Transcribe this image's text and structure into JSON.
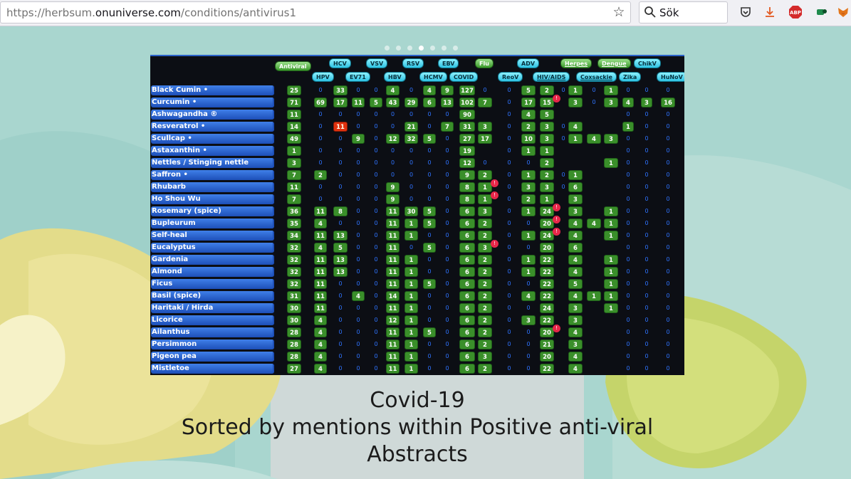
{
  "browser": {
    "url_prefix": "https://herbsum.",
    "url_host": "onuniverse.com",
    "url_path": "/conditions/antivirus1",
    "search_placeholder": "Sök"
  },
  "carousel": {
    "dot_count": 7,
    "active_index": 3
  },
  "table": {
    "headers_top": [
      "Antiviral",
      "HCV",
      "VSV",
      "RSV",
      "EBV",
      "Flu",
      "ADV",
      "Herpes",
      "Dengue",
      "ChikV"
    ],
    "headers_bottom": [
      "HPV",
      "EV71",
      "HBV",
      "HCMV",
      "COVID",
      "ReoV",
      "HIV/AIDS",
      "Coxsackie",
      "Zika",
      "HuNoV"
    ],
    "rows": [
      {
        "name": "Black Cumin •",
        "cells": [
          "25",
          "0",
          "33",
          "0",
          "0",
          "4",
          "0",
          "4",
          "9",
          "127",
          "0",
          "0",
          "5",
          "2",
          "0",
          "1",
          "0",
          "1",
          "0",
          "0",
          "0"
        ]
      },
      {
        "name": "Curcumin •",
        "cells": [
          "71",
          "69",
          "17",
          "11",
          "5",
          "43",
          "29",
          "6",
          "13",
          "102",
          "7",
          "0",
          "17",
          "15",
          "",
          "3",
          "0",
          "3",
          "4",
          "3",
          "16"
        ]
      },
      {
        "name": "Ashwagandha ®",
        "cells": [
          "11",
          "0",
          "0",
          "0",
          "0",
          "0",
          "0",
          "0",
          "0",
          "90",
          "",
          "0",
          "4",
          "5",
          "",
          "",
          "",
          "",
          "0",
          "0",
          "0"
        ]
      },
      {
        "name": "Resveratrol •",
        "cells": [
          "14",
          "0",
          "11",
          "0",
          "0",
          "0",
          "21",
          "0",
          "7",
          "31",
          "3",
          "0",
          "2",
          "3",
          "0",
          "4",
          "",
          "",
          "1",
          "0",
          "0"
        ]
      },
      {
        "name": "Scullcap •",
        "cells": [
          "49",
          "0",
          "0",
          "9",
          "0",
          "12",
          "32",
          "5",
          "0",
          "27",
          "17",
          "0",
          "10",
          "3",
          "0",
          "1",
          "4",
          "3",
          "0",
          "0",
          "0"
        ]
      },
      {
        "name": "Astaxanthin •",
        "cells": [
          "1",
          "0",
          "0",
          "0",
          "0",
          "0",
          "0",
          "0",
          "0",
          "19",
          "",
          "0",
          "1",
          "1",
          "",
          "",
          "",
          "",
          "0",
          "0",
          "0"
        ]
      },
      {
        "name": "Nettles / Stinging nettle",
        "cells": [
          "3",
          "0",
          "0",
          "0",
          "0",
          "0",
          "0",
          "0",
          "0",
          "12",
          "0",
          "0",
          "0",
          "2",
          "",
          "",
          "",
          "1",
          "0",
          "0",
          "0"
        ]
      },
      {
        "name": "Saffron •",
        "cells": [
          "7",
          "2",
          "0",
          "0",
          "0",
          "0",
          "0",
          "0",
          "0",
          "9",
          "2",
          "0",
          "1",
          "2",
          "0",
          "1",
          "",
          "",
          "0",
          "0",
          "0"
        ]
      },
      {
        "name": "Rhubarb",
        "cells": [
          "11",
          "0",
          "0",
          "0",
          "0",
          "9",
          "0",
          "0",
          "0",
          "8",
          "1",
          "0",
          "3",
          "3",
          "0",
          "6",
          "",
          "",
          "0",
          "0",
          "0"
        ]
      },
      {
        "name": "Ho Shou Wu",
        "cells": [
          "7",
          "0",
          "0",
          "0",
          "0",
          "9",
          "0",
          "0",
          "0",
          "8",
          "1",
          "0",
          "2",
          "1",
          "",
          "3",
          "",
          "",
          "0",
          "0",
          "0"
        ]
      },
      {
        "name": "Rosemary (spice)",
        "cells": [
          "36",
          "11",
          "8",
          "0",
          "0",
          "11",
          "30",
          "5",
          "0",
          "6",
          "3",
          "0",
          "1",
          "24",
          "",
          "3",
          "",
          "1",
          "0",
          "0",
          "0"
        ]
      },
      {
        "name": "Bupleurum",
        "cells": [
          "35",
          "4",
          "0",
          "0",
          "0",
          "11",
          "1",
          "5",
          "0",
          "6",
          "2",
          "0",
          "0",
          "20",
          "",
          "4",
          "4",
          "1",
          "0",
          "0",
          "0"
        ]
      },
      {
        "name": "Self-heal",
        "cells": [
          "34",
          "11",
          "13",
          "0",
          "0",
          "11",
          "1",
          "0",
          "0",
          "6",
          "2",
          "0",
          "1",
          "24",
          "",
          "4",
          "",
          "1",
          "0",
          "0",
          "0"
        ]
      },
      {
        "name": "Eucalyptus",
        "cells": [
          "32",
          "4",
          "5",
          "0",
          "0",
          "11",
          "0",
          "5",
          "0",
          "6",
          "3",
          "0",
          "0",
          "20",
          "",
          "6",
          "",
          "",
          "0",
          "0",
          "0"
        ]
      },
      {
        "name": "Gardenia",
        "cells": [
          "32",
          "11",
          "13",
          "0",
          "0",
          "11",
          "1",
          "0",
          "0",
          "6",
          "2",
          "0",
          "1",
          "22",
          "",
          "4",
          "",
          "1",
          "0",
          "0",
          "0"
        ]
      },
      {
        "name": "Almond",
        "cells": [
          "32",
          "11",
          "13",
          "0",
          "0",
          "11",
          "1",
          "0",
          "0",
          "6",
          "2",
          "0",
          "1",
          "22",
          "",
          "4",
          "",
          "1",
          "0",
          "0",
          "0"
        ]
      },
      {
        "name": "Ficus",
        "cells": [
          "32",
          "11",
          "0",
          "0",
          "0",
          "11",
          "1",
          "5",
          "0",
          "6",
          "2",
          "0",
          "0",
          "22",
          "",
          "5",
          "",
          "1",
          "0",
          "0",
          "0"
        ]
      },
      {
        "name": "Basil (spice)",
        "cells": [
          "31",
          "11",
          "0",
          "4",
          "0",
          "14",
          "1",
          "0",
          "0",
          "6",
          "2",
          "0",
          "4",
          "22",
          "",
          "4",
          "1",
          "1",
          "0",
          "0",
          "0"
        ]
      },
      {
        "name": "Haritaki / Hirda",
        "cells": [
          "30",
          "11",
          "0",
          "0",
          "0",
          "11",
          "1",
          "0",
          "0",
          "6",
          "2",
          "0",
          "0",
          "24",
          "",
          "3",
          "",
          "1",
          "0",
          "0",
          "0"
        ]
      },
      {
        "name": "Licorice",
        "cells": [
          "30",
          "4",
          "0",
          "0",
          "0",
          "12",
          "1",
          "0",
          "0",
          "6",
          "2",
          "0",
          "3",
          "22",
          "",
          "3",
          "",
          "",
          "0",
          "0",
          "0"
        ]
      },
      {
        "name": "Ailanthus",
        "cells": [
          "28",
          "4",
          "0",
          "0",
          "0",
          "11",
          "1",
          "5",
          "0",
          "6",
          "2",
          "0",
          "0",
          "20",
          "",
          "4",
          "",
          "",
          "0",
          "0",
          "0"
        ]
      },
      {
        "name": "Persimmon",
        "cells": [
          "28",
          "4",
          "0",
          "0",
          "0",
          "11",
          "1",
          "0",
          "0",
          "6",
          "2",
          "0",
          "0",
          "21",
          "",
          "3",
          "",
          "",
          "0",
          "0",
          "0"
        ]
      },
      {
        "name": "Pigeon pea",
        "cells": [
          "28",
          "4",
          "0",
          "0",
          "0",
          "11",
          "1",
          "0",
          "0",
          "6",
          "3",
          "0",
          "0",
          "20",
          "",
          "4",
          "",
          "",
          "0",
          "0",
          "0"
        ]
      },
      {
        "name": "Mistletoe",
        "cells": [
          "27",
          "4",
          "0",
          "0",
          "0",
          "11",
          "1",
          "0",
          "0",
          "6",
          "2",
          "0",
          "0",
          "22",
          "",
          "4",
          "",
          "",
          "0",
          "0",
          "0"
        ]
      }
    ],
    "red_cells": [
      [
        3,
        2
      ]
    ],
    "alerts": [
      [
        1,
        13
      ],
      [
        8,
        10
      ],
      [
        9,
        10
      ],
      [
        10,
        13
      ],
      [
        11,
        13
      ],
      [
        12,
        13
      ],
      [
        13,
        10
      ],
      [
        20,
        13
      ]
    ]
  },
  "caption": {
    "line1": "Covid-19",
    "line2": "Sorted by mentions within Positive anti-viral Abstracts"
  },
  "colors": {
    "bg": "#a9d6cf",
    "cell_green": "#3a8f2a",
    "herb_blue": "#1d4fb8",
    "zero_blue": "#2f73ff"
  }
}
